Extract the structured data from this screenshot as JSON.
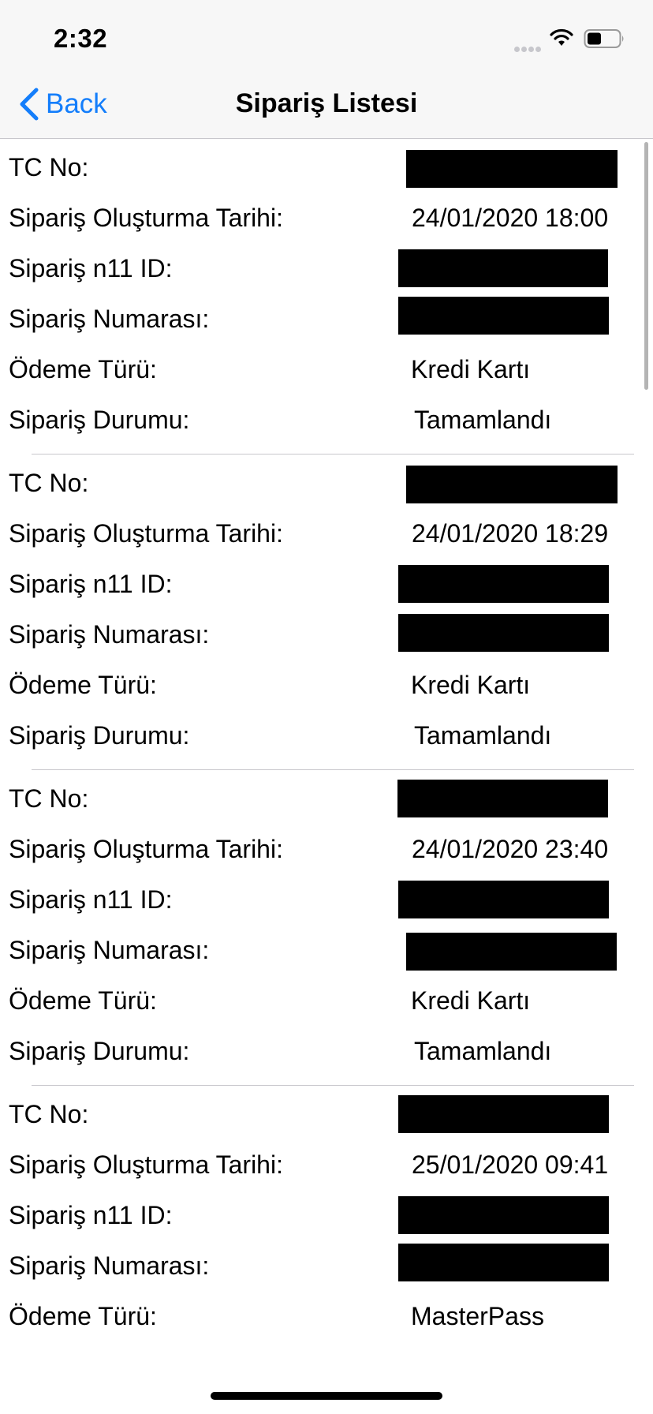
{
  "status_bar": {
    "time": "2:32"
  },
  "nav": {
    "back_label": "Back",
    "title": "Sipariş Listesi"
  },
  "labels": {
    "tc_no": "TC No:",
    "created": "Sipariş Oluşturma Tarihi:",
    "n11_id": "Sipariş n11 ID:",
    "order_number": "Sipariş Numarası:",
    "payment_type": "Ödeme Türü:",
    "status": "Sipariş Durumu:"
  },
  "orders": [
    {
      "tc_no": "[redacted]",
      "created": "24/01/2020 18:00",
      "n11_id": "[redacted]",
      "order_number": "[redacted]",
      "payment_type": "Kredi Kartı",
      "status": "Tamamlandı"
    },
    {
      "tc_no": "[redacted]",
      "created": "24/01/2020 18:29",
      "n11_id": "[redacted]",
      "order_number": "[redacted]",
      "payment_type": "Kredi Kartı",
      "status": "Tamamlandı"
    },
    {
      "tc_no": "[redacted]",
      "created": "24/01/2020 23:40",
      "n11_id": "[redacted]",
      "order_number": "[redacted]",
      "payment_type": "Kredi Kartı",
      "status": "Tamamlandı"
    },
    {
      "tc_no": "[redacted]",
      "created": "25/01/2020 09:41",
      "n11_id": "[redacted]",
      "order_number": "[redacted]",
      "payment_type": "MasterPass",
      "status": ""
    }
  ],
  "colors": {
    "accent": "#147efb",
    "nav_background": "#f7f7f7",
    "separator": "#c8c7cc",
    "redaction": "#000000"
  }
}
